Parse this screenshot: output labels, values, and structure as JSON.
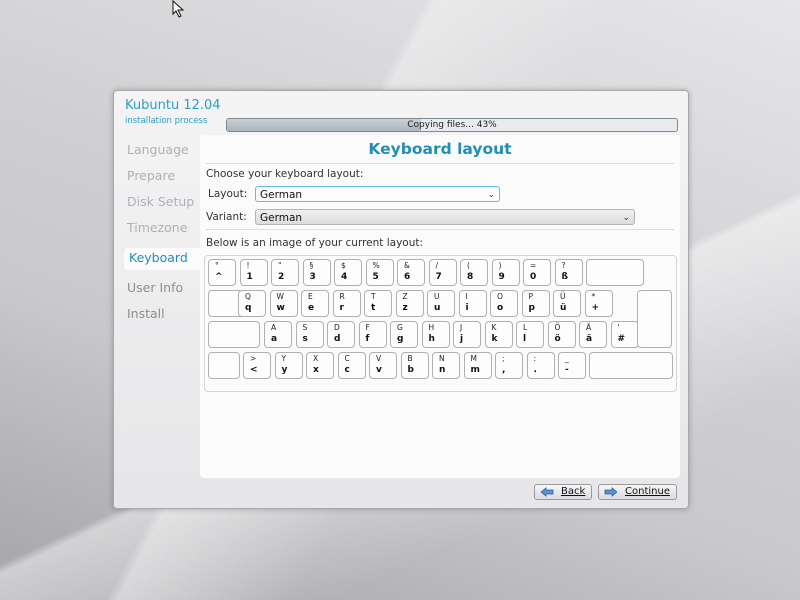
{
  "app": {
    "title": "Kubuntu 12.04",
    "subtitle": "installation process"
  },
  "progress": {
    "text": "Copying files... 43%",
    "percent": 43
  },
  "steps": [
    "Language",
    "Prepare",
    "Disk Setup",
    "Timezone",
    "Keyboard",
    "User Info",
    "Install"
  ],
  "active_step": "Keyboard",
  "page": {
    "title": "Keyboard layout",
    "choose_label": "Choose your keyboard layout:",
    "layout_label": "Layout:",
    "layout_value": "German",
    "variant_label": "Variant:",
    "variant_value": "German",
    "image_label": "Below is an image of your current layout:"
  },
  "keyboard": {
    "rows": [
      [
        [
          "°",
          "^"
        ],
        [
          "!",
          "1"
        ],
        [
          "\"",
          "2"
        ],
        [
          "§",
          "3"
        ],
        [
          "$",
          "4"
        ],
        [
          "%",
          "5"
        ],
        [
          "&",
          "6"
        ],
        [
          "/",
          "7"
        ],
        [
          "(",
          "8"
        ],
        [
          ")",
          "9"
        ],
        [
          "=",
          "0"
        ],
        [
          "?",
          "ß"
        ],
        [
          "",
          ""
        ]
      ],
      [
        [
          "Q",
          "q"
        ],
        [
          "W",
          "w"
        ],
        [
          "E",
          "e"
        ],
        [
          "R",
          "r"
        ],
        [
          "T",
          "t"
        ],
        [
          "Z",
          "z"
        ],
        [
          "U",
          "u"
        ],
        [
          "I",
          "i"
        ],
        [
          "O",
          "o"
        ],
        [
          "P",
          "p"
        ],
        [
          "Ü",
          "ü"
        ],
        [
          "*",
          "+"
        ]
      ],
      [
        [
          "A",
          "a"
        ],
        [
          "S",
          "s"
        ],
        [
          "D",
          "d"
        ],
        [
          "F",
          "f"
        ],
        [
          "G",
          "g"
        ],
        [
          "H",
          "h"
        ],
        [
          "J",
          "j"
        ],
        [
          "K",
          "k"
        ],
        [
          "L",
          "l"
        ],
        [
          "Ö",
          "ö"
        ],
        [
          "Ä",
          "ä"
        ],
        [
          "'",
          "#"
        ]
      ],
      [
        [
          ">",
          "<"
        ],
        [
          "Y",
          "y"
        ],
        [
          "X",
          "x"
        ],
        [
          "C",
          "c"
        ],
        [
          "V",
          "v"
        ],
        [
          "B",
          "b"
        ],
        [
          "N",
          "n"
        ],
        [
          "M",
          "m"
        ],
        [
          ";",
          ","
        ],
        [
          ":",
          "."
        ],
        [
          "_",
          "-"
        ]
      ]
    ]
  },
  "buttons": {
    "back": "Back",
    "continue": "Continue"
  },
  "colors": {
    "accent": "#1f8fb8",
    "brand": "#2aa0c8"
  }
}
